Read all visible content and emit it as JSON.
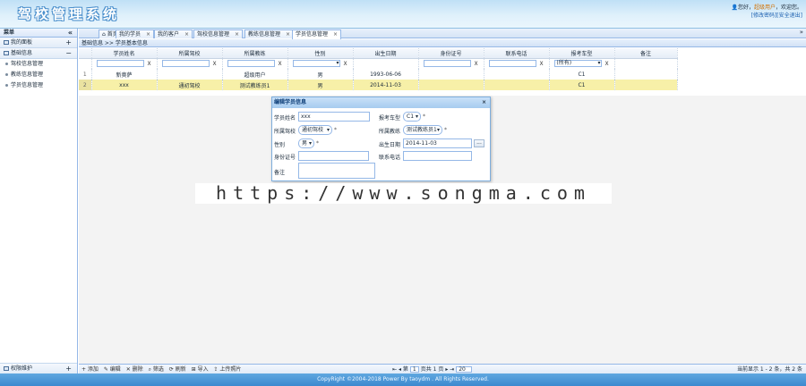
{
  "app": {
    "title": "驾校管理系统"
  },
  "user": {
    "greeting": "您好，",
    "name": "超级用户",
    "welcome": "，欢迎您。",
    "links": "[修改密码][安全退出]"
  },
  "sidebar": {
    "header": "菜单",
    "collapse_icon": "«",
    "groups": [
      {
        "label": "我的面板",
        "tool": "+"
      },
      {
        "label": "基础信息",
        "tool": "−"
      }
    ],
    "items": [
      {
        "label": "驾校信息管理"
      },
      {
        "label": "教练信息管理"
      },
      {
        "label": "学员信息管理"
      }
    ],
    "bottom_group": {
      "label": "权限维护",
      "tool": "+"
    }
  },
  "tabs": {
    "items": [
      {
        "label": "首页",
        "closable": false
      },
      {
        "label": "我的学员",
        "closable": true
      },
      {
        "label": "我的客户",
        "closable": true
      },
      {
        "label": "驾校信息管理",
        "closable": true
      },
      {
        "label": "教练信息管理",
        "closable": true
      },
      {
        "label": "学员信息管理",
        "closable": true
      }
    ],
    "scroll_icon": "»"
  },
  "breadcrumb": "基础信息 >> 学员基本信息",
  "grid": {
    "columns": [
      "学员姓名",
      "所属驾校",
      "所属教练",
      "性别",
      "出生日期",
      "身份证号",
      "联系电话",
      "报考车型",
      "备注"
    ],
    "filter_clear": "X",
    "filter_gender": "",
    "filter_car": "(所有)",
    "rows": [
      {
        "num": "1",
        "cells": [
          "新奥萨",
          "",
          "超级用户",
          "男",
          "1993-06-06",
          "",
          "",
          "C1",
          ""
        ]
      },
      {
        "num": "2",
        "cells": [
          "xxx",
          "通初驾校",
          "测试教练员1",
          "男",
          "2014-11-03",
          "",
          "",
          "C1",
          ""
        ]
      }
    ]
  },
  "pager": {
    "buttons": [
      "+ 添加",
      "✎ 编辑",
      "✕ 删除",
      "⌕ 筛选",
      "⟳ 刷新",
      "⊞ 导入",
      "⇪ 上传照片"
    ],
    "first": "⇤",
    "prev": "◂",
    "page_label": "第",
    "page": "1",
    "of": "页共 1 页",
    "next": "▸",
    "last": "⇥",
    "size": "20",
    "info": "当前显示 1 - 2 条，共 2 条"
  },
  "dialog": {
    "title": "编辑学员信息",
    "close": "×",
    "fields": {
      "name_label": "学员姓名",
      "name_value": "xxx",
      "car_label": "报考车型",
      "car_value": "C1",
      "school_label": "所属驾校",
      "school_value": "通初驾校",
      "coach_label": "所属教练",
      "coach_value": "测试教练员1",
      "gender_label": "性别",
      "gender_value": "男",
      "birth_label": "出生日期",
      "birth_value": "2014-11-03",
      "id_label": "身份证号",
      "id_value": "",
      "phone_label": "联系电话",
      "phone_value": "",
      "note_label": "备注",
      "note_value": "",
      "required_mark": "*",
      "date_button": "..."
    }
  },
  "watermark": "https://www.songma.com",
  "footer": "CopyRight ©2004-2018 Power By taoydm . All Rights Reserved."
}
